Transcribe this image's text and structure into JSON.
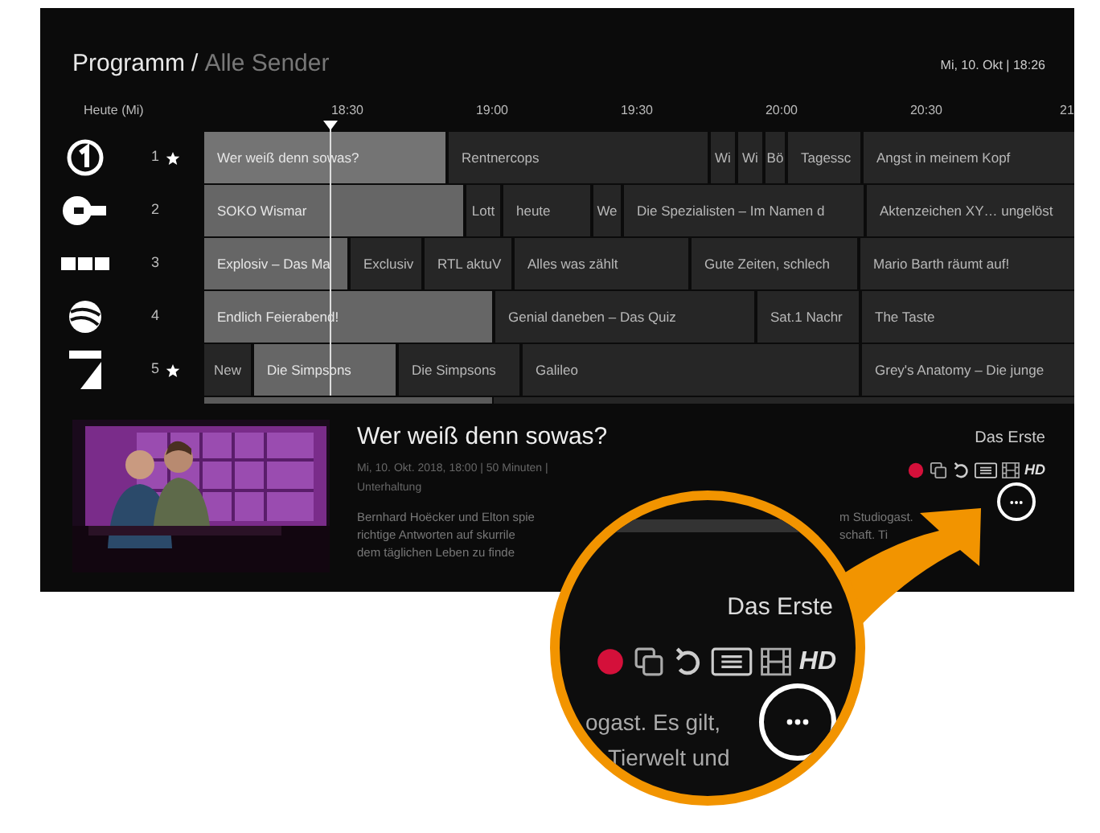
{
  "header": {
    "title": "Programm",
    "separator": "/",
    "subtitle": "Alle Sender",
    "datetime": "Mi, 10. Okt | 18:26"
  },
  "timeline": {
    "day": "Heute (Mi)",
    "times": [
      "18:30",
      "19:00",
      "19:30",
      "20:00",
      "20:30",
      "21"
    ]
  },
  "channels": [
    {
      "kind": "ring",
      "number": "1",
      "favorite": true,
      "programs": [
        {
          "title": "Wer weiß denn sowas?",
          "live": true,
          "selected": true
        },
        {
          "title": "Rentnercops",
          "live": false,
          "selected": false
        },
        {
          "title": "Wi",
          "live": false,
          "selected": false
        },
        {
          "title": "Wi",
          "live": false,
          "selected": false
        },
        {
          "title": "Bö",
          "live": false,
          "selected": false
        },
        {
          "title": "Tagessc",
          "live": false,
          "selected": false
        },
        {
          "title": "Angst in meinem Kopf",
          "live": false,
          "selected": false
        }
      ]
    },
    {
      "kind": "disc",
      "number": "2",
      "favorite": false,
      "programs": [
        {
          "title": "SOKO Wismar",
          "live": true,
          "selected": false
        },
        {
          "title": "Lott",
          "live": false,
          "selected": false
        },
        {
          "title": "heute",
          "live": false,
          "selected": false
        },
        {
          "title": "We",
          "live": false,
          "selected": false
        },
        {
          "title": "Die Spezialisten – Im Namen d",
          "live": false,
          "selected": false
        },
        {
          "title": "Aktenzeichen XY… ungelöst",
          "live": false,
          "selected": false
        }
      ]
    },
    {
      "kind": "bars",
      "number": "3",
      "favorite": false,
      "programs": [
        {
          "title": "Explosiv – Das Ma",
          "live": true,
          "selected": false
        },
        {
          "title": "Exclusiv",
          "live": false,
          "selected": false
        },
        {
          "title": "RTL aktuV",
          "live": false,
          "selected": false
        },
        {
          "title": "Alles was zählt",
          "live": false,
          "selected": false
        },
        {
          "title": "Gute Zeiten, schlech",
          "live": false,
          "selected": false
        },
        {
          "title": "Mario Barth räumt auf!",
          "live": false,
          "selected": false
        }
      ]
    },
    {
      "kind": "ball",
      "number": "4",
      "favorite": false,
      "programs": [
        {
          "title": "Endlich Feierabend!",
          "live": true,
          "selected": false
        },
        {
          "title": "Genial daneben – Das Quiz",
          "live": false,
          "selected": false
        },
        {
          "title": "Sat.1 Nachr",
          "live": false,
          "selected": false
        },
        {
          "title": "The Taste",
          "live": false,
          "selected": false
        }
      ]
    },
    {
      "kind": "seven",
      "number": "5",
      "favorite": true,
      "programs": [
        {
          "title": "New",
          "live": false,
          "selected": false
        },
        {
          "title": "Die Simpsons",
          "live": true,
          "selected": false
        },
        {
          "title": "Die Simpsons",
          "live": false,
          "selected": false
        },
        {
          "title": "Galileo",
          "live": false,
          "selected": false
        },
        {
          "title": "Grey's Anatomy – Die junge",
          "live": false,
          "selected": false
        }
      ]
    }
  ],
  "detail": {
    "title": "Wer weiß denn sowas?",
    "channel": "Das Erste",
    "meta": "Mi, 10. Okt. 2018, 18:00 | 50 Minuten |",
    "genre": "Unterhaltung",
    "recording": true,
    "hd": "HD",
    "description": [
      {
        "left": "Bernhard Hoëcker und Elton spie",
        "right": "m Studiogast."
      },
      {
        "left": "richtige Antworten auf skurrile",
        "right": "schaft. Ti"
      },
      {
        "left": "dem täglichen Leben zu finde"
      }
    ]
  },
  "magnifier": {
    "channel": "Das Erste",
    "recording": true,
    "hd": "HD",
    "description": [
      "ogast. Es gilt,",
      "Tierwelt und"
    ]
  }
}
